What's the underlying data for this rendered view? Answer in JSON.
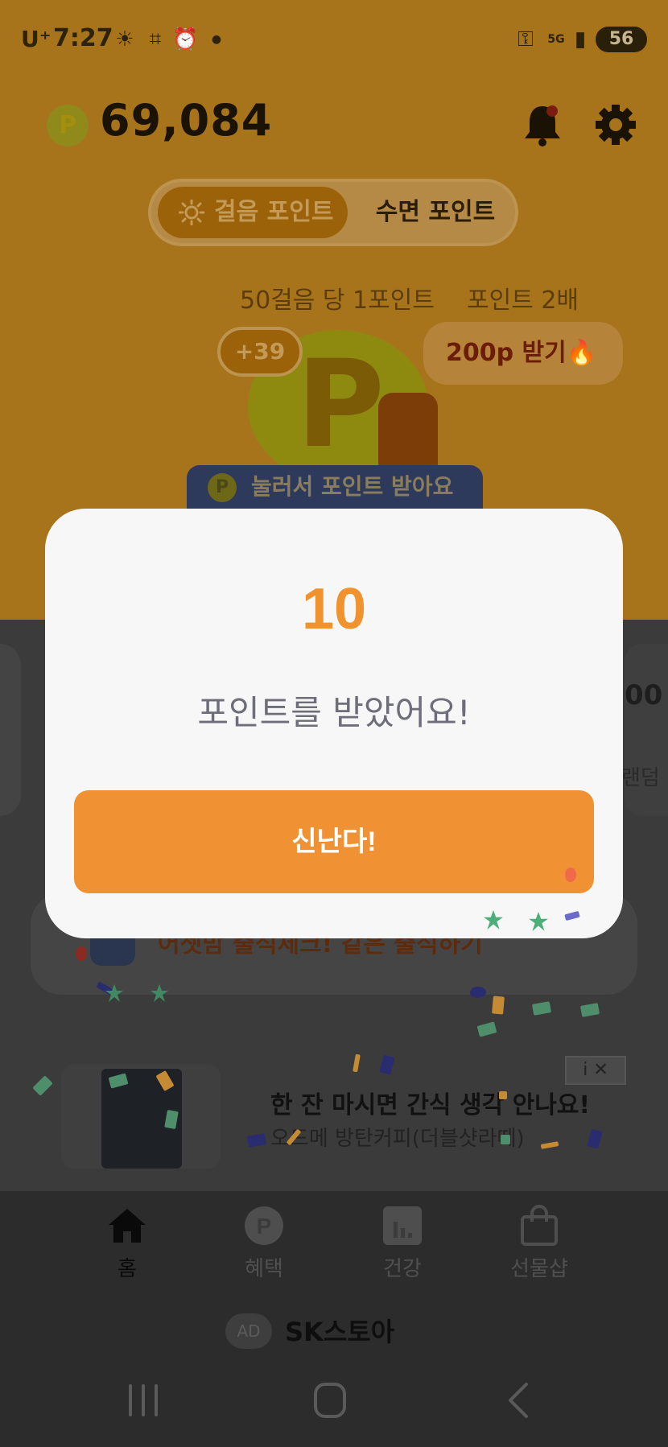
{
  "status_bar": {
    "carrier": "U⁺",
    "time": "7:27",
    "battery": "56",
    "network": "5G"
  },
  "header": {
    "coin_letter": "P",
    "points_total": "69,084"
  },
  "mode_toggle": {
    "active_label": "걸음 포인트",
    "inactive_label": "수면 포인트"
  },
  "rates": {
    "rate_text": "50걸음 당 1포인트",
    "double_text": "포인트 2배"
  },
  "reward": {
    "bonus": "+39",
    "claim_label": "200p 받기🔥",
    "coin_letter": "P",
    "tooltip": "눌러서 포인트 받아요"
  },
  "side_cards": {
    "right_number": "00",
    "right_sub": "랜덤"
  },
  "attendance": {
    "text": "어젯밤 출석체크! 같은 출석하기"
  },
  "ad": {
    "title": "한 잔 마시면 간식 생각 안나요!",
    "subtitle": "오드메 방탄커피(더블샷라떼)",
    "info_label": "i ✕"
  },
  "bottom_nav": {
    "items": [
      {
        "label": "홈",
        "icon": "home-icon"
      },
      {
        "label": "혜택",
        "icon": "points-icon"
      },
      {
        "label": "건강",
        "icon": "chart-icon"
      },
      {
        "label": "선물샵",
        "icon": "shopping-bag-icon"
      }
    ]
  },
  "ad_footer": {
    "chip": "AD",
    "store": "SK스토아"
  },
  "dialog": {
    "points": "10",
    "message": "포인트를 받았어요!",
    "confirm_label": "신난다!"
  },
  "colors": {
    "accent": "#f09234",
    "dialog_bg": "#f7f7f7",
    "message_text": "#6e6e7a"
  }
}
